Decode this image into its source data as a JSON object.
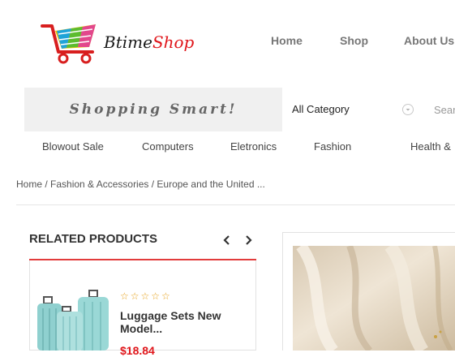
{
  "header": {
    "logo_text_main": "Btime",
    "logo_text_accent": "Shop",
    "nav": [
      "Home",
      "Shop",
      "About Us"
    ]
  },
  "search": {
    "slogan": "Shopping Smart!",
    "category_selected": "All Category",
    "placeholder": "Search"
  },
  "categories": [
    "Blowout Sale",
    "Computers",
    "Eletronics",
    "Fashion",
    "Health &"
  ],
  "breadcrumb": "Home / Fashion & Accessories / Europe and the United ...",
  "related": {
    "title": "RELATED PRODUCTS",
    "product": {
      "stars": "☆☆☆☆☆",
      "name": "Luggage Sets New Model...",
      "price": "$18.84"
    }
  },
  "colors": {
    "accent_red": "#e0161b",
    "band_bg": "#f0f0f0",
    "star": "#e6a118"
  }
}
